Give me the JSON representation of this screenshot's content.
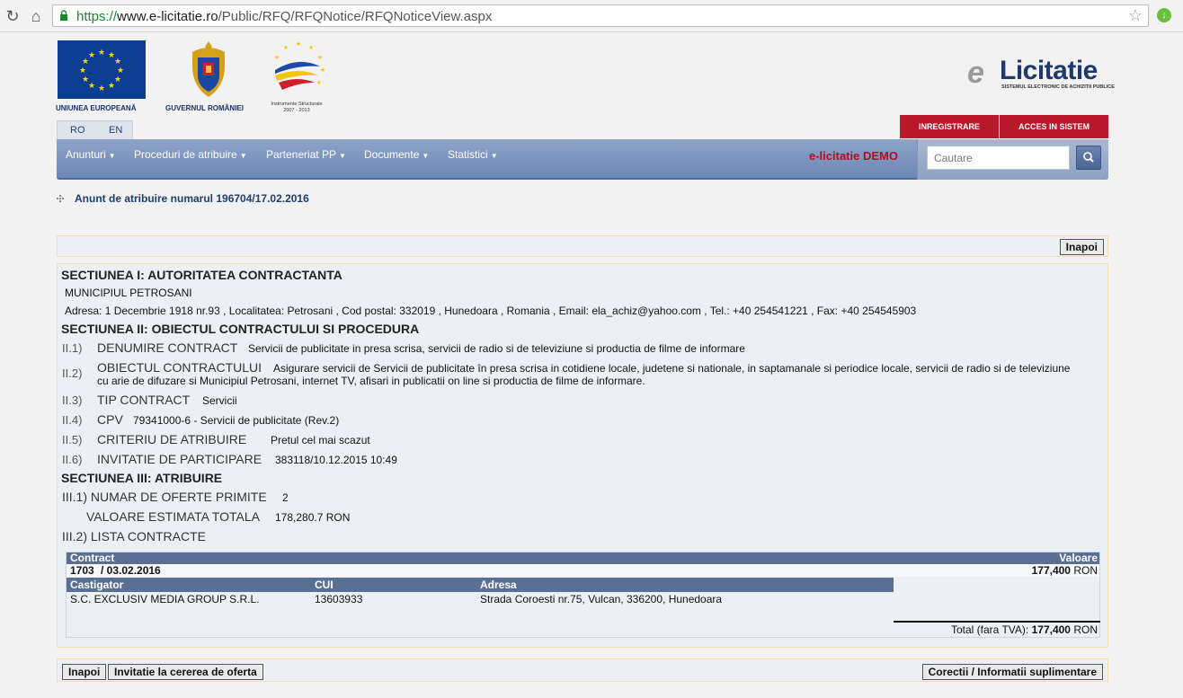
{
  "browser": {
    "url_scheme": "https://",
    "url_host": "www.e-licitatie.ro",
    "url_path": "/Public/RFQ/RFQNotice/RFQNoticeView.aspx"
  },
  "header": {
    "eu_caption": "UNIUNEA EUROPEANĂ",
    "gov_caption": "GUVERNUL ROMÂNIEI",
    "is_caption_line1": "Instrumente Structurale",
    "is_caption_line2": "2007 - 2013",
    "brand_e": "e",
    "brand_word": "Licitatie",
    "brand_sub": "SISTEMUL ELECTRONIC DE ACHIZITII PUBLICE",
    "lang_ro": "RO",
    "lang_en": "EN",
    "register_label": "INREGISTRARE",
    "login_label": "ACCES IN SISTEM"
  },
  "nav": {
    "items": [
      "Anunturi",
      "Proceduri de atribuire",
      "Parteneriat PP",
      "Documente",
      "Statistici"
    ],
    "caret": "▼",
    "demo_label": "e-licitatie DEMO",
    "search_placeholder": "Cautare"
  },
  "breadcrumb": "Anunt de atribuire numarul 196704/17.02.2016",
  "buttons": {
    "back": "Inapoi",
    "invitation": "Invitatie la cererea de oferta",
    "corrections": "Corectii / Informatii suplimentare"
  },
  "section1": {
    "title": "SECTIUNEA I: AUTORITATEA CONTRACTANTA",
    "authority": "MUNICIPIUL PETROSANI",
    "address_line": "Adresa:  1 Decembrie 1918 nr.93 , Localitatea:  Petrosani , Cod postal:  332019 , Hunedoara , Romania , Email:  ela_achiz@yahoo.com , Tel.:  +40 254541221 , Fax:  +40 254545903"
  },
  "section2": {
    "title": "SECTIUNEA II: OBIECTUL CONTRACTULUI SI PROCEDURA",
    "rows": [
      {
        "num": "II.1)",
        "label": "DENUMIRE CONTRACT",
        "value": "Servicii de publicitate in presa scrisa, servicii de radio si de televiziune si productia de filme de informare"
      },
      {
        "num": "II.2)",
        "label": "OBIECTUL CONTRACTULUI",
        "value": "Asigurare servicii de Servicii de publicitate în presa scrisa in cotidiene locale, judetene si nationale, in saptamanale si periodice locale, servicii de radio si de televiziune",
        "value2": "cu arie de difuzare si Municipiul Petrosani, internet TV, afisari in publicatii on line si productia de filme de informare."
      },
      {
        "num": "II.3)",
        "label": "TIP CONTRACT",
        "value": "Servicii"
      },
      {
        "num": "II.4)",
        "label": "CPV",
        "value": "79341000-6 - Servicii de publicitate (Rev.2)"
      },
      {
        "num": "II.5)",
        "label": "CRITERIU DE ATRIBUIRE",
        "value": "Pretul cel mai scazut"
      },
      {
        "num": "II.6)",
        "label": "INVITATIE DE PARTICIPARE",
        "value": "383118/10.12.2015 10:49"
      }
    ]
  },
  "section3": {
    "title": "SECTIUNEA III: ATRIBUIRE",
    "offers_label": "III.1) NUMAR DE OFERTE PRIMITE",
    "offers_value": "2",
    "estimate_label": "VALOARE ESTIMATA TOTALA",
    "estimate_value": "178,280.7 RON",
    "list_label": "III.2) LISTA CONTRACTE"
  },
  "contracts": {
    "col_contract": "Contract",
    "col_value": "Valoare",
    "contract_number": "1703",
    "contract_date": "/ 03.02.2016",
    "contract_value_bold": "177,400",
    "currency": "RON",
    "col_winner": "Castigator",
    "col_cui": "CUI",
    "col_address": "Adresa",
    "winner": "S.C. EXCLUSIV MEDIA GROUP S.R.L.",
    "cui": "13603933",
    "winner_address": "Strada Coroesti nr.75, Vulcan, 336200, Hunedoara",
    "total_label": "Total (fara TVA):",
    "total_value": "177,400"
  }
}
